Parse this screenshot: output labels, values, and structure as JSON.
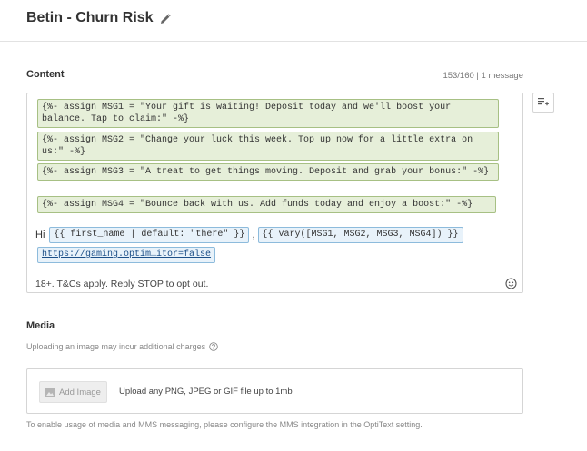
{
  "header": {
    "title": "Betin - Churn Risk"
  },
  "content": {
    "label": "Content",
    "counter": "153/160 | 1 message",
    "blocks": [
      "{%- assign MSG1 = \"Your gift is waiting! Deposit today and we'll boost your balance. Tap to claim:\" -%}",
      "{%- assign MSG2 = \"Change your luck this week. Top up now for a little extra on us:\" -%}",
      "{%- assign MSG3 = \"A treat to get things moving. Deposit and grab your bonus:\" -%}",
      "{%- assign MSG4 = \"Bounce back with us. Add funds today and enjoy a boost:\" -%}"
    ],
    "greeting": "Hi",
    "first_name_tag": "{{ first_name | default: \"there\" }}",
    "separator": ",",
    "vary_tag": "{{ vary([MSG1, MSG2, MSG3, MSG4]) }}",
    "link": "https://gaming.optim…itor=false",
    "footer": "18+. T&Cs apply. Reply STOP to opt out."
  },
  "media": {
    "label": "Media",
    "hint": "Uploading an image may incur additional charges",
    "add_image_label": "Add Image",
    "upload_text": "Upload any PNG, JPEG or GIF file up to 1mb",
    "note": "To enable usage of media and MMS messaging, please configure the MMS integration in the OptiText setting."
  },
  "icons": {
    "edit": "pencil-icon",
    "insert": "insert-block-icon",
    "emoji": "smiley-icon",
    "help": "help-circle-icon",
    "image": "image-icon"
  }
}
